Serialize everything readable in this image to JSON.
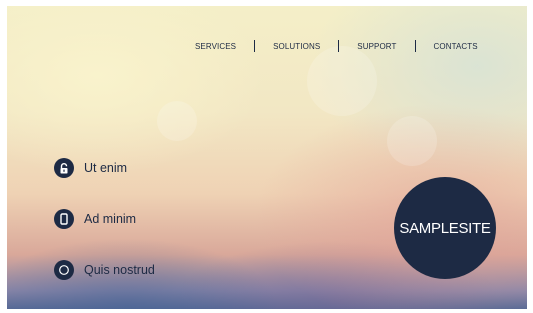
{
  "nav": {
    "items": [
      {
        "label": "SERVICES"
      },
      {
        "label": "SOLUTIONS"
      },
      {
        "label": "SUPPORT"
      },
      {
        "label": "CONTACTS"
      }
    ]
  },
  "features": [
    {
      "label": "Ut enim",
      "icon": "lock-icon"
    },
    {
      "label": "Ad minim",
      "icon": "phone-icon"
    },
    {
      "label": "Quis nostrud",
      "icon": "circle-icon"
    }
  ],
  "logo": {
    "text": "SAMPLESITE"
  },
  "colors": {
    "primary": "#1d2a44",
    "logo_text": "#ffffff"
  }
}
